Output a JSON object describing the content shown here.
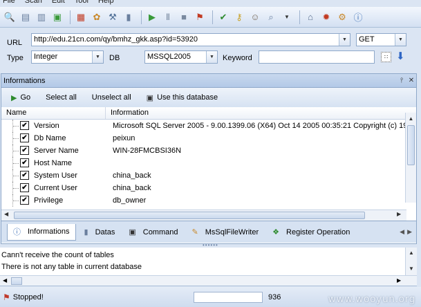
{
  "menu": [
    "File",
    "Scan",
    "Edit",
    "Tool",
    "Help"
  ],
  "url_label": "URL",
  "url_value": "http://edu.21cn.com/qy/bmhz_gkk.asp?id=53920",
  "method_value": "GET",
  "type_label": "Type",
  "type_value": "Integer",
  "db_label": "DB",
  "db_value": "MSSQL2005",
  "keyword_label": "Keyword",
  "keyword_value": "",
  "panel_title": "Informations",
  "actions": {
    "go": "Go",
    "select_all": "Select all",
    "unselect_all": "Unselect all",
    "use_db": "Use this database"
  },
  "columns": {
    "name": "Name",
    "info": "Information"
  },
  "rows": [
    {
      "name": "Version",
      "value": "Microsoft SQL Server 2005 - 9.00.1399.06 (X64) Oct 14 2005 00:35:21 Copyright (c) 19"
    },
    {
      "name": "Db Name",
      "value": "peixun"
    },
    {
      "name": "Server Name",
      "value": "WIN-28FMCBSI36N"
    },
    {
      "name": "Host Name",
      "value": ""
    },
    {
      "name": "System User",
      "value": "china_back"
    },
    {
      "name": "Current User",
      "value": "china_back"
    },
    {
      "name": "Privilege",
      "value": "db_owner"
    }
  ],
  "tabs": [
    "Informations",
    "Datas",
    "Command",
    "MsSqlFileWriter",
    "Register Operation"
  ],
  "log": [
    "Cann't receive the count of tables",
    "There is not any table in current database"
  ],
  "status": {
    "text": "Stopped!",
    "count": "936"
  },
  "watermark": "www.wooyun.org"
}
